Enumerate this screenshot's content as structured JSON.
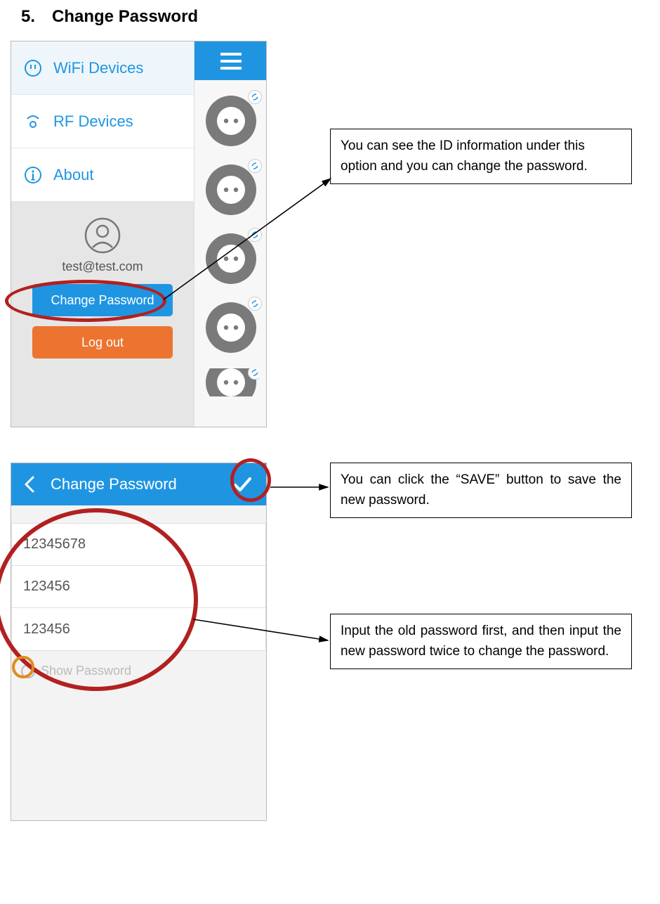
{
  "page_heading": "5. Change Password",
  "screenshot1": {
    "menu": {
      "wifi": "WiFi Devices",
      "rf": "RF Devices",
      "about": "About"
    },
    "account": {
      "email": "test@test.com",
      "change_password_btn": "Change Password",
      "logout_btn": "Log out"
    }
  },
  "annotation1": "You can see the ID information under this option and you can change the password.",
  "screenshot2": {
    "titlebar": "Change Password",
    "fields": {
      "old": "12345678",
      "new1": "123456",
      "new2": "123456"
    },
    "show_password_label": "Show Password"
  },
  "annotation2": "You can click the “SAVE” button to save the new password.",
  "annotation3": "Input the old password first, and then input the new password twice to change the password."
}
